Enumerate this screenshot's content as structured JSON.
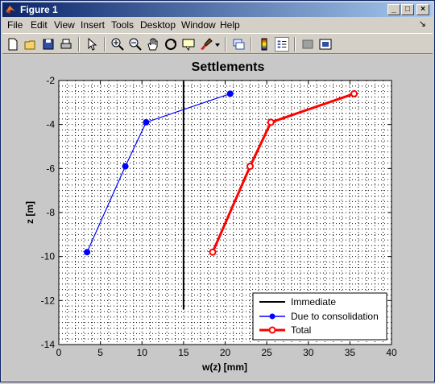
{
  "window": {
    "title": "Figure 1",
    "controls": {
      "minimize": "_",
      "maximize": "□",
      "close": "×"
    }
  },
  "menubar": {
    "items": [
      "File",
      "Edit",
      "View",
      "Insert",
      "Tools",
      "Desktop",
      "Window",
      "Help"
    ],
    "dock_glyph": "↘"
  },
  "toolbar": {
    "tools": [
      "new-figure-icon",
      "open-file-icon",
      "save-icon",
      "print-icon",
      "edit-plot-arrow-icon",
      "zoom-in-icon",
      "zoom-out-icon",
      "pan-hand-icon",
      "rotate-3d-icon",
      "data-cursor-icon",
      "brush-icon",
      "brush-dropdown-icon",
      "link-plot-icon",
      "insert-colorbar-icon",
      "insert-legend-icon",
      "hide-plot-tools-icon",
      "show-plot-tools-icon"
    ]
  },
  "colors": {
    "blue": "#0000ff",
    "red": "#ff0000",
    "black": "#000000"
  },
  "chart_data": {
    "type": "line",
    "title": "Settlements",
    "xlabel": "w(z) [mm]",
    "ylabel": "z [m]",
    "xlim": [
      0,
      40
    ],
    "ylim": [
      -14,
      -2
    ],
    "xticks": [
      0,
      5,
      10,
      15,
      20,
      25,
      30,
      35,
      40
    ],
    "yticks": [
      -2,
      -4,
      -6,
      -8,
      -10,
      -12,
      -14
    ],
    "grid": true,
    "legend_position": "lower-right",
    "series": [
      {
        "name": "Immediate",
        "color": "black",
        "marker": "none",
        "x": [
          15,
          15
        ],
        "y": [
          -2,
          -12.4
        ]
      },
      {
        "name": "Due to consolidation",
        "color": "blue",
        "marker": "filled-circle",
        "x": [
          20.6,
          10.5,
          8,
          3.4
        ],
        "y": [
          -2.6,
          -3.9,
          -5.9,
          -9.8
        ]
      },
      {
        "name": "Total",
        "color": "red",
        "marker": "open-circle",
        "x": [
          35.5,
          25.5,
          23,
          18.5
        ],
        "y": [
          -2.6,
          -3.9,
          -5.9,
          -9.8
        ]
      }
    ]
  }
}
